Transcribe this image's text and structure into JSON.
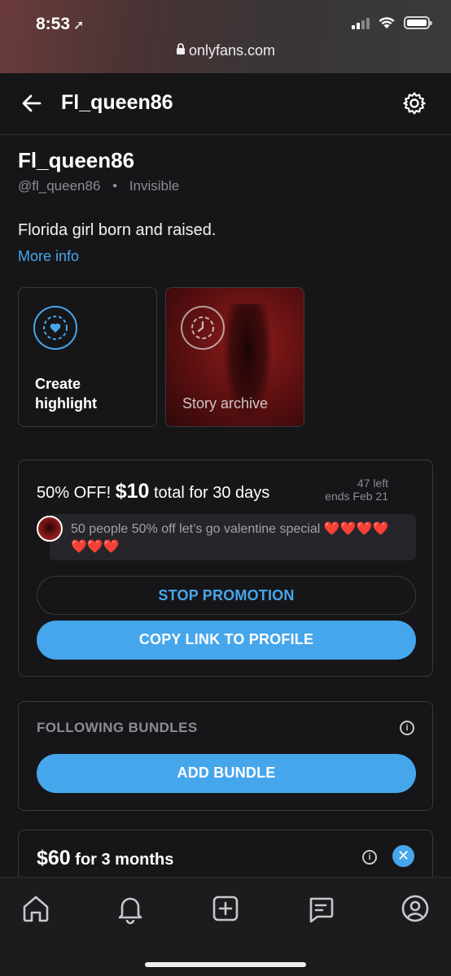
{
  "status_bar": {
    "time": "8:53",
    "url": "onlyfans.com"
  },
  "header": {
    "title": "Fl_queen86"
  },
  "profile": {
    "display_name": "Fl_queen86",
    "handle": "@fl_queen86",
    "separator": "•",
    "status": "Invisible",
    "bio": "Florida girl born and raised.",
    "more_info": "More info"
  },
  "highlights": [
    {
      "label_line1": "Create",
      "label_line2": "highlight"
    },
    {
      "label": "Story archive"
    }
  ],
  "promotion": {
    "title_prefix": "50% OFF!",
    "price": "$10",
    "title_suffix": "total for 30 days",
    "left": "47 left",
    "ends": "ends Feb 21",
    "message": "50 people 50% off let’s go valentine special",
    "hearts_line1": "❤️❤️❤️❤️",
    "hearts_line2": "❤️❤️❤️",
    "stop_label": "STOP PROMOTION",
    "copy_label": "COPY LINK TO PROFILE"
  },
  "bundles": {
    "title": "FOLLOWING BUNDLES",
    "add_label": "ADD BUNDLE",
    "item_price": "$60",
    "item_duration": "for 3 months",
    "info_symbol": "i",
    "close_symbol": "✕"
  },
  "colors": {
    "accent": "#46a6ec",
    "background": "#161618",
    "border": "#3a3a3e",
    "muted": "#8a8d93"
  },
  "nav_icons": [
    "home-icon",
    "bell-icon",
    "plus-square-icon",
    "message-icon",
    "profile-icon"
  ]
}
